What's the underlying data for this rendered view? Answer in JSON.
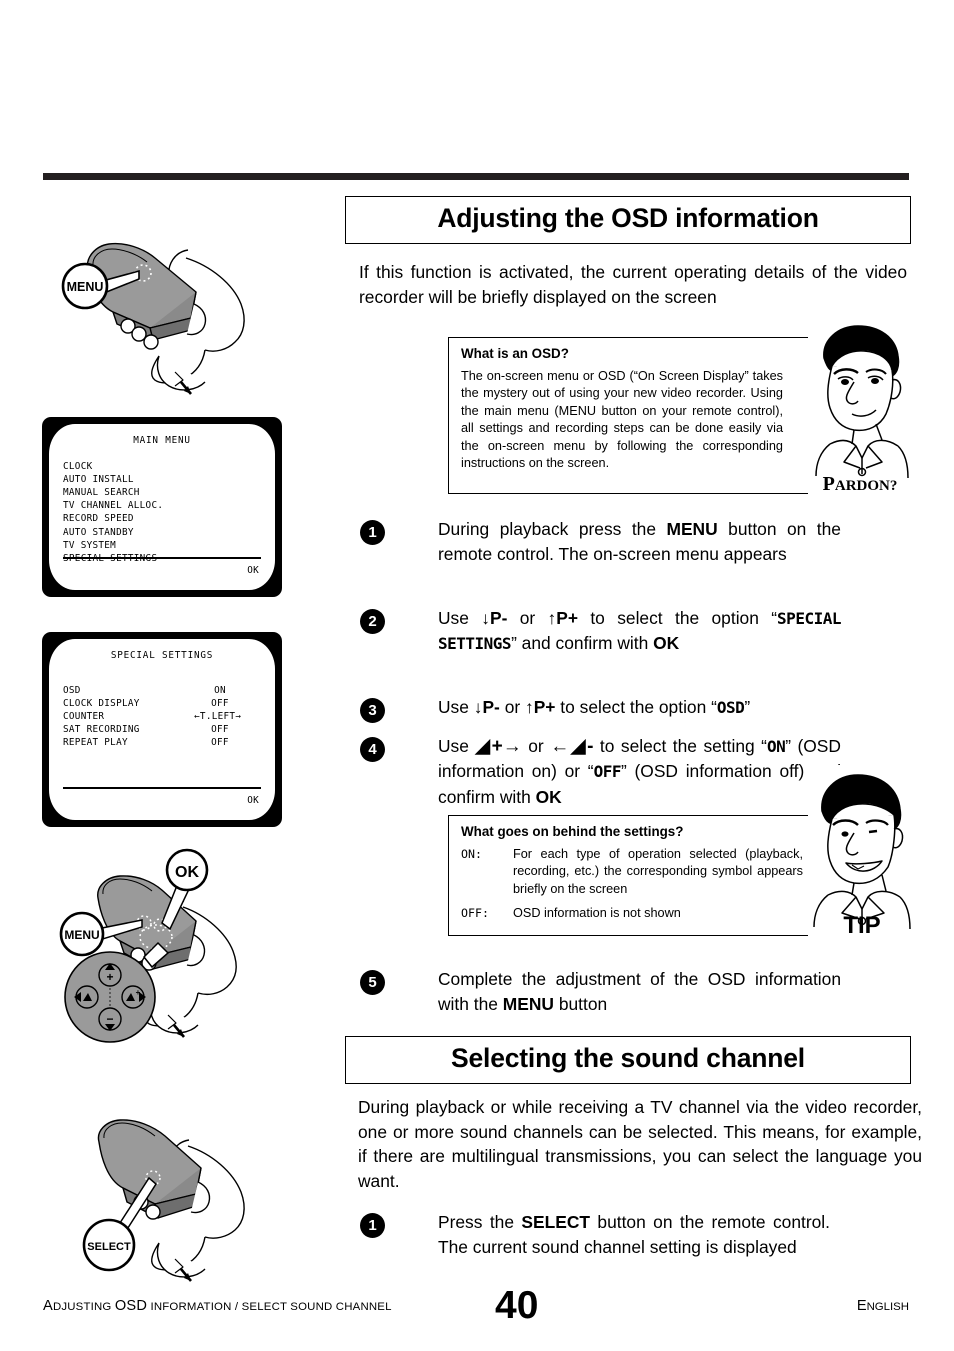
{
  "document": {
    "page_number": "40",
    "footer_left_caps": "A",
    "footer_left_rest": "DJUSTING ",
    "footer_left_osd": "OSD",
    "footer_left_tail": " INFORMATION / SELECT SOUND CHANNEL",
    "footer_right_caps": "E",
    "footer_right_rest": "NGLISH"
  },
  "section1": {
    "heading": "Adjusting the OSD information",
    "intro": "If this function is activated, the current operating details of the video recorder will be briefly displayed on the screen",
    "infobox": {
      "title": "What is an OSD?",
      "body": "The on-screen menu or OSD (“On Screen Display” takes the mystery out of using your new video recorder. Using the main menu (MENU button on your remote control), all settings and recording steps can be done easily via the on-screen menu by following the corresponding instructions on the screen.",
      "character_label": "PARDON?",
      "character_label_cap": "P",
      "character_label_rest": "ARDON?"
    },
    "steps": [
      {
        "num": "1",
        "parts": [
          {
            "t": "During playback press the ",
            "s": "n"
          },
          {
            "t": "MENU",
            "s": "b"
          },
          {
            "t": " button on the remote control. The on-screen menu appears",
            "s": "n"
          }
        ]
      },
      {
        "num": "2",
        "parts": [
          {
            "t": "Use ",
            "s": "n"
          },
          {
            "t": "↓P-",
            "s": "b"
          },
          {
            "t": " or ",
            "s": "n"
          },
          {
            "t": "↑P+",
            "s": "b"
          },
          {
            "t": " to select the option “",
            "s": "n"
          },
          {
            "t": "SPECIAL SETTINGS",
            "s": "m"
          },
          {
            "t": "” and confirm with ",
            "s": "n"
          },
          {
            "t": "OK",
            "s": "b"
          }
        ]
      },
      {
        "num": "3",
        "parts": [
          {
            "t": "Use ",
            "s": "n"
          },
          {
            "t": "↓P-",
            "s": "b"
          },
          {
            "t": " or ",
            "s": "n"
          },
          {
            "t": "↑P+",
            "s": "b"
          },
          {
            "t": " to select the option “",
            "s": "n"
          },
          {
            "t": "OSD",
            "s": "m"
          },
          {
            "t": "”",
            "s": "n"
          }
        ]
      },
      {
        "num": "4",
        "parts": [
          {
            "t": "Use ",
            "s": "n"
          },
          {
            "t": "◢+→",
            "s": "b"
          },
          {
            "t": " or ",
            "s": "n"
          },
          {
            "t": "←◢-",
            "s": "b"
          },
          {
            "t": " to select the setting “",
            "s": "n"
          },
          {
            "t": "ON",
            "s": "m"
          },
          {
            "t": "” (OSD information on) or “",
            "s": "n"
          },
          {
            "t": "OFF",
            "s": "m"
          },
          {
            "t": "” (OSD information off) and confirm with ",
            "s": "n"
          },
          {
            "t": "OK",
            "s": "b"
          }
        ]
      },
      {
        "num": "5",
        "parts": [
          {
            "t": "Complete the adjustment of the OSD information with the ",
            "s": "n"
          },
          {
            "t": "MENU",
            "s": "b"
          },
          {
            "t": " button",
            "s": "n"
          }
        ]
      }
    ],
    "tipbox": {
      "title": "What goes on behind the settings?",
      "row_on_label": "ON:",
      "row_on_text": "For each type of operation selected (playback, recording, etc.) the corresponding symbol appears briefly on the screen",
      "row_off_label": "OFF:",
      "row_off_text": "OSD information is not shown",
      "character_label": "TIP"
    }
  },
  "section2": {
    "heading": "Selecting the sound channel",
    "intro": "During playback or while receiving a TV channel via the video recorder, one or more sound channels can be selected. This means, for example, if there are multilingual transmissions, you can select the language you want.",
    "steps": [
      {
        "num": "1",
        "parts": [
          {
            "t": "Press the ",
            "s": "n"
          },
          {
            "t": "SELECT",
            "s": "b"
          },
          {
            "t": " button on the remote control. The current sound channel setting is displayed",
            "s": "n"
          }
        ]
      }
    ]
  },
  "tv_screens": [
    {
      "title": "MAIN MENU",
      "rows": [
        {
          "label": "CLOCK",
          "value": ""
        },
        {
          "label": "AUTO INSTALL",
          "value": ""
        },
        {
          "label": "MANUAL SEARCH",
          "value": ""
        },
        {
          "label": "TV CHANNEL ALLOC.",
          "value": ""
        },
        {
          "label": "RECORD SPEED",
          "value": ""
        },
        {
          "label": "AUTO STANDBY",
          "value": ""
        },
        {
          "label": "TV SYSTEM",
          "value": ""
        },
        {
          "label": "SPECIAL SETTINGS",
          "value": ""
        }
      ],
      "ok": "OK"
    },
    {
      "title": "SPECIAL SETTINGS",
      "rows": [
        {
          "label": "OSD",
          "value": "ON"
        },
        {
          "label": "CLOCK DISPLAY",
          "value": "OFF"
        },
        {
          "label": "COUNTER",
          "value": "←T.LEFT→"
        },
        {
          "label": "SAT RECORDING",
          "value": "OFF"
        },
        {
          "label": "REPEAT PLAY",
          "value": "OFF"
        }
      ],
      "ok": "OK"
    }
  ],
  "illustrations": [
    {
      "name": "remote-menu-press",
      "callouts": [
        "MENU"
      ]
    },
    {
      "name": "remote-ok-cursor",
      "callouts": [
        "OK",
        "MENU"
      ]
    },
    {
      "name": "remote-select-press",
      "callouts": [
        "SELECT"
      ]
    }
  ],
  "colors": {
    "rule": "#231f20",
    "remote_body": "#9a9a9a",
    "remote_shadow": "#6e6e6e",
    "screen_frame": "#000000"
  }
}
